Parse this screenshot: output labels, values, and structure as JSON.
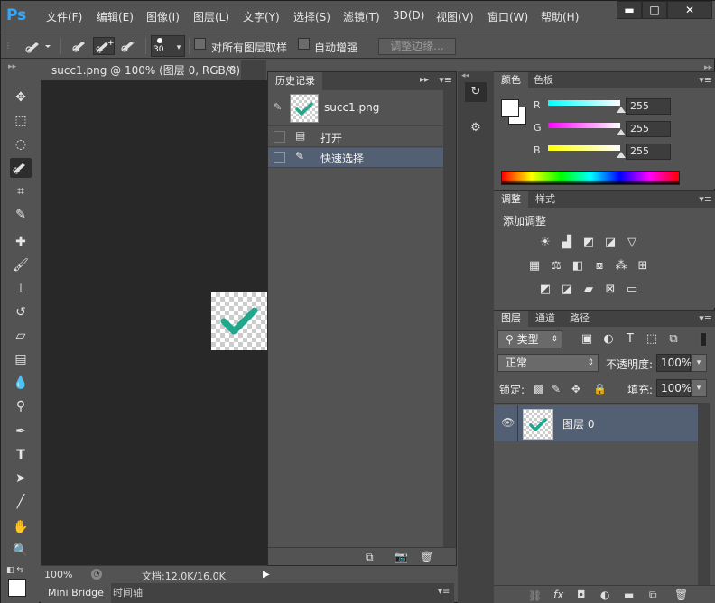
{
  "app": {
    "logo": "Ps"
  },
  "menu": [
    "文件(F)",
    "编辑(E)",
    "图像(I)",
    "图层(L)",
    "文字(Y)",
    "选择(S)",
    "滤镜(T)",
    "3D(D)",
    "视图(V)",
    "窗口(W)",
    "帮助(H)"
  ],
  "window_controls": {
    "minimize": "▬",
    "maximize": "□",
    "close": "✕"
  },
  "options": {
    "brush_size": "30",
    "sample_all_layers": "对所有图层取样",
    "auto_enhance": "自动增强",
    "refine_edge": "调整边缘..."
  },
  "document": {
    "tab_title": "succ1.png @ 100% (图层 0, RGB/8)",
    "close": "×",
    "zoom": "100%",
    "doc_info": "文档:12.0K/16.0K"
  },
  "bottom_tabs": [
    "Mini Bridge",
    "时间轴"
  ],
  "history": {
    "tab": "历史记录",
    "snapshot": "succ1.png",
    "items": [
      "打开",
      "快速选择"
    ]
  },
  "color": {
    "tabs": [
      "颜色",
      "色板"
    ],
    "channels": [
      {
        "label": "R",
        "value": "255"
      },
      {
        "label": "G",
        "value": "255"
      },
      {
        "label": "B",
        "value": "255"
      }
    ]
  },
  "adjustments": {
    "tabs": [
      "调整",
      "样式"
    ],
    "title": "添加调整"
  },
  "layers": {
    "tabs": [
      "图层",
      "通道",
      "路径"
    ],
    "filter_kind": "类型",
    "blend_mode": "正常",
    "opacity_label": "不透明度:",
    "opacity": "100%",
    "lock_label": "锁定:",
    "fill_label": "填充:",
    "fill": "100%",
    "layer_name": "图层 0"
  },
  "colors": {
    "accent": "#31a8ff",
    "selected_row": "#536073",
    "check_mark": "#1fa88b"
  }
}
